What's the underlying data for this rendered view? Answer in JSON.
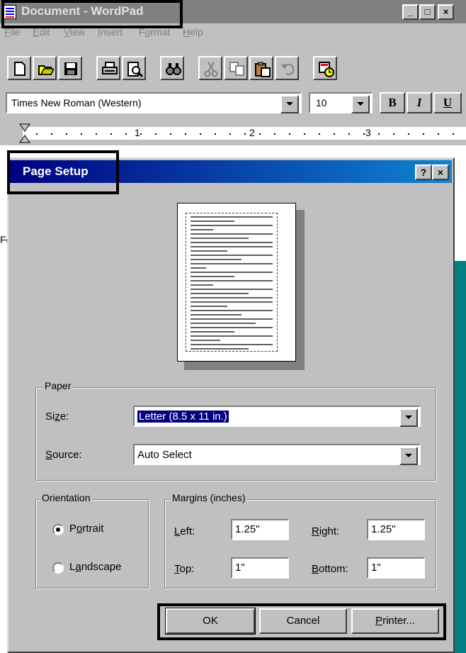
{
  "window": {
    "title": "Document - WordPad",
    "min_label": "_",
    "max_label": "□",
    "close_label": "×"
  },
  "menu": [
    {
      "key": "F",
      "rest": "ile"
    },
    {
      "key": "E",
      "rest": "dit"
    },
    {
      "key": "V",
      "rest": "iew"
    },
    {
      "key": "I",
      "rest": "nsert"
    },
    {
      "pre": "F",
      "key": "o",
      "rest": "rmat"
    },
    {
      "key": "H",
      "rest": "elp"
    }
  ],
  "toolbar_icons": [
    "new-icon",
    "open-icon",
    "save-icon",
    "print-icon",
    "print-preview-icon",
    "find-icon",
    "cut-icon",
    "copy-icon",
    "paste-icon",
    "undo-icon",
    "insert-datetime-icon"
  ],
  "format_bar": {
    "font": "Times New Roman (Western)",
    "size": "10",
    "bold": "B",
    "italic": "I",
    "underline": "U"
  },
  "ruler": {
    "marks": [
      "1",
      "2",
      "3"
    ]
  },
  "status_stub": "Fo",
  "dialog": {
    "title": "Page Setup",
    "help_label": "?",
    "close_label": "×",
    "paper": {
      "group_label": "Paper",
      "size_label_pre": "Si",
      "size_label_key": "z",
      "size_label_post": "e:",
      "size_value": "Letter (8.5 x 11 in.)",
      "source_label_key": "S",
      "source_label_post": "ource:",
      "source_value": "Auto Select"
    },
    "orientation": {
      "group_label": "Orientation",
      "portrait_pre": "P",
      "portrait_key": "o",
      "portrait_post": "rtrait",
      "landscape_pre": "L",
      "landscape_key": "a",
      "landscape_post": "ndscape",
      "selected": "portrait"
    },
    "margins": {
      "group_label": "Margins (inches)",
      "left_key": "L",
      "left_post": "eft:",
      "left_value": "1.25\"",
      "right_key": "R",
      "right_post": "ight:",
      "right_value": "1.25\"",
      "top_key": "T",
      "top_post": "op:",
      "top_value": "1\"",
      "bottom_key": "B",
      "bottom_post": "ottom:",
      "bottom_value": "1\""
    },
    "buttons": {
      "ok": "OK",
      "cancel": "Cancel",
      "printer_key": "P",
      "printer_post": "rinter..."
    }
  }
}
